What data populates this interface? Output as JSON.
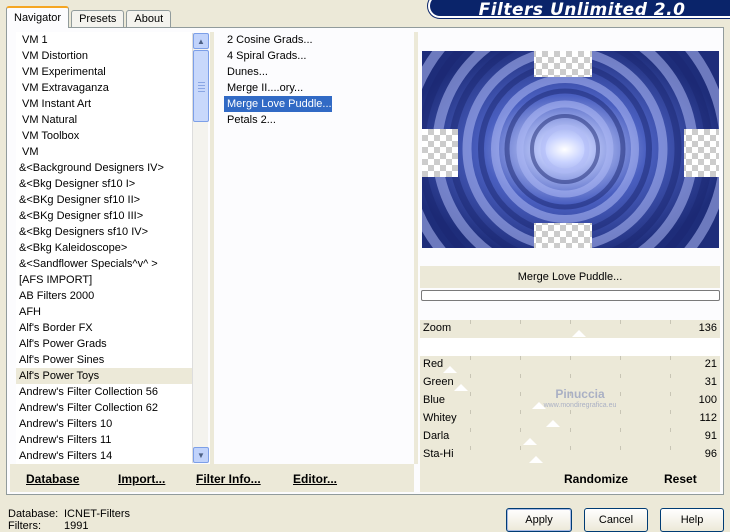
{
  "tabs": [
    {
      "label": "Navigator",
      "active": true
    },
    {
      "label": "Presets",
      "active": false
    },
    {
      "label": "About",
      "active": false
    }
  ],
  "banner": {
    "title": "Filters Unlimited 2.0",
    "color": "#0a246a"
  },
  "categories": {
    "selected_index": 21,
    "items": [
      "VM 1",
      "VM Distortion",
      "VM Experimental",
      "VM Extravaganza",
      "VM Instant Art",
      "VM Natural",
      "VM Toolbox",
      "VM",
      "&<Background Designers IV>",
      "&<Bkg Designer sf10 I>",
      "&<BKg Designer sf10 II>",
      "&<BKg Designer sf10 III>",
      "&<Bkg Designers sf10 IV>",
      "&<Bkg Kaleidoscope>",
      "&<Sandflower Specials^v^ >",
      "[AFS IMPORT]",
      "AB Filters 2000",
      "AFH",
      "Alf's Border FX",
      "Alf's Power Grads",
      "Alf's Power Sines",
      "Alf's Power Toys",
      "Andrew's Filter Collection 56",
      "Andrew's Filter Collection 62",
      "Andrew's Filters 10",
      "Andrew's Filters 11",
      "Andrew's Filters 14"
    ]
  },
  "filters": {
    "selected_index": 4,
    "items": [
      "2 Cosine Grads...",
      "4 Spiral Grads...",
      "Dunes...",
      "Merge II....ory...",
      "Merge Love Puddle...",
      "Petals 2..."
    ]
  },
  "preview": {
    "filter_name": "Merge Love Puddle...",
    "base_color": "#2a3b8f"
  },
  "params": {
    "zoom": {
      "name": "Zoom",
      "value": "136",
      "fraction": 0.53
    },
    "sliders": [
      {
        "name": "Red",
        "value": "21",
        "fraction": 0.08
      },
      {
        "name": "Green",
        "value": "31",
        "fraction": 0.12
      },
      {
        "name": "Blue",
        "value": "100",
        "fraction": 0.39
      },
      {
        "name": "Whitey",
        "value": "112",
        "fraction": 0.44
      },
      {
        "name": "Darla",
        "value": "91",
        "fraction": 0.36
      },
      {
        "name": "Sta-Hi",
        "value": "96",
        "fraction": 0.38
      }
    ]
  },
  "watermark": {
    "name": "Pinuccia",
    "url": "www.mondiregrafica.eu"
  },
  "buttons": {
    "database": "Database",
    "import": "Import...",
    "filter_info": "Filter Info...",
    "editor": "Editor...",
    "randomize": "Randomize",
    "reset": "Reset",
    "apply": "Apply",
    "cancel": "Cancel",
    "help": "Help"
  },
  "status": {
    "database_label": "Database:",
    "database_value": "ICNET-Filters",
    "filters_label": "Filters:",
    "filters_value": "1991"
  }
}
